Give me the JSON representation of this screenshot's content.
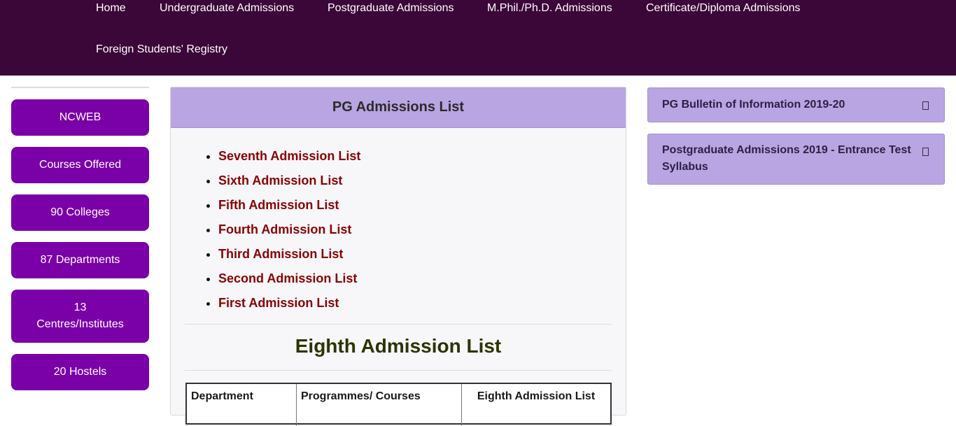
{
  "nav": {
    "items": [
      "Home",
      "Undergraduate Admissions",
      "Postgraduate Admissions",
      "M.Phil./Ph.D. Admissions",
      "Certificate/Diploma Admissions",
      "Foreign Students' Registry"
    ]
  },
  "sidebar": {
    "buttons": [
      "NCWEB",
      "Courses Offered",
      "90 Colleges",
      "87 Departments",
      "13 Centres/Institutes",
      "20 Hostels"
    ]
  },
  "panel": {
    "title": "PG Admissions List",
    "lists": [
      "Seventh Admission List",
      "Sixth Admission List",
      "Fifth Admission List",
      "Fourth Admission List",
      "Third Admission List",
      "Second Admission List",
      "First Admission List"
    ],
    "section_title": "Eighth Admission List",
    "table": {
      "headers": [
        "Department",
        "Programmes/ Courses",
        "Eighth Admission List"
      ]
    }
  },
  "right": {
    "accordions": [
      "PG Bulletin of Information 2019-20",
      "Postgraduate Admissions 2019 - Entrance Test Syllabus"
    ]
  },
  "colors": {
    "nav_bg": "#3b0738",
    "sidebar_button": "#7a00a8",
    "panel_header": "#b8a5e2",
    "link": "#8b0000"
  }
}
